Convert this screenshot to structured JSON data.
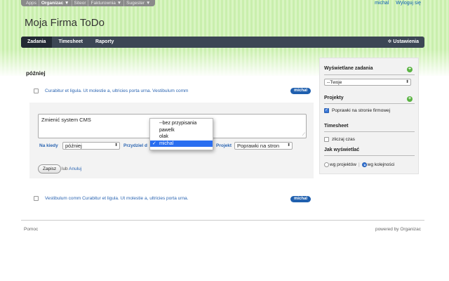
{
  "topbar": {
    "items": [
      "Apps",
      "Organizac ▼",
      "Siteor",
      "Fakturownia ▼",
      "Sugester ▼"
    ],
    "user": "michal",
    "logout": "Wyloguj się"
  },
  "app": {
    "title": "Moja Firma ToDo"
  },
  "nav": {
    "tabs": [
      "Zadania",
      "Timesheet",
      "Raporty"
    ],
    "settings": "Ustawienia"
  },
  "main": {
    "section_title": "później",
    "tasks": [
      {
        "text": "Curabitur et ligula. Ut molestie a, ultricies porta urna. Vestibulum comm",
        "assignee": "michal"
      },
      {
        "text": "Vestibulum comm Curabitur et ligula. Ut molestie a, ultricies porta urna.",
        "assignee": "michal"
      }
    ],
    "edit": {
      "text": "Zmienić system CMS",
      "when_label": "Na kiedy",
      "when_value": "później",
      "assign_label": "Przydziel d",
      "project_label": "Projekt",
      "project_value": "Poprawki na stron",
      "save_label": "Zapisz",
      "or_label": "lub",
      "cancel_label": "Anuluj",
      "assign_options": [
        "--bez przypisania",
        "pawelk",
        "olak",
        "michal"
      ],
      "assign_selected": "michal"
    }
  },
  "sidebar": {
    "tasks_head": "Wyświetlane zadania",
    "tasks_filter": "--Twoje",
    "projects_head": "Projekty",
    "project_item": "Poprawki na stronie firmowej",
    "timesheet_head": "Timesheet",
    "timesheet_check": "zliczaj czas",
    "display_head": "Jak wyświetlać",
    "display_opt1": "wg projektów",
    "display_opt2": "wg kolejności"
  },
  "footer": {
    "help": "Pomoc",
    "powered": "powered by Organizac"
  }
}
